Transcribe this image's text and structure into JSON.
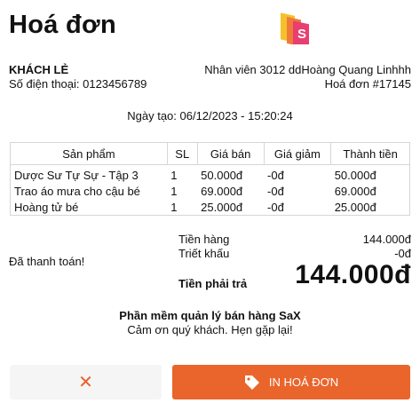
{
  "header": {
    "title": "Hoá đơn"
  },
  "customer": {
    "name": "KHÁCH LẺ",
    "phone": "Số điện thoại: 0123456789"
  },
  "staff": "Nhân viên 3012 ddHoàng Quang Linhhh",
  "invoice_no": "Hoá đơn #17145",
  "created": "Ngày tạo: 06/12/2023 - 15:20:24",
  "table": {
    "headers": [
      "Sản phẩm",
      "SL",
      "Giá bán",
      "Giá giảm",
      "Thành tiền"
    ],
    "rows": [
      [
        "Dược Sư Tự Sự - Tập 3",
        "1",
        "50.000đ",
        "-0đ",
        "50.000đ"
      ],
      [
        "Trao áo mưa cho cậu bé",
        "1",
        "69.000đ",
        "-0đ",
        "69.000đ"
      ],
      [
        "Hoàng tử bé",
        "1",
        "25.000đ",
        "-0đ",
        "25.000đ"
      ]
    ]
  },
  "summary": {
    "paid_label": "Đã thanh toán!",
    "subtotal_label": "Tiền hàng",
    "subtotal": "144.000đ",
    "discount_label": "Triết khấu",
    "discount": "-0đ",
    "total_label": "Tiền phải trả",
    "total": "144.000đ"
  },
  "footer": {
    "brand": "Phần mềm quản lý bán hàng SaX",
    "thanks": "Cảm ơn quý khách. Hẹn gặp lại!"
  },
  "buttons": {
    "cancel_icon": "close-icon",
    "print_label": "IN HOÁ ĐƠN",
    "print_icon": "tag-icon"
  },
  "colors": {
    "accent": "#e9652b",
    "logo_yellow": "#f5c12b",
    "logo_pink": "#e83e70"
  }
}
